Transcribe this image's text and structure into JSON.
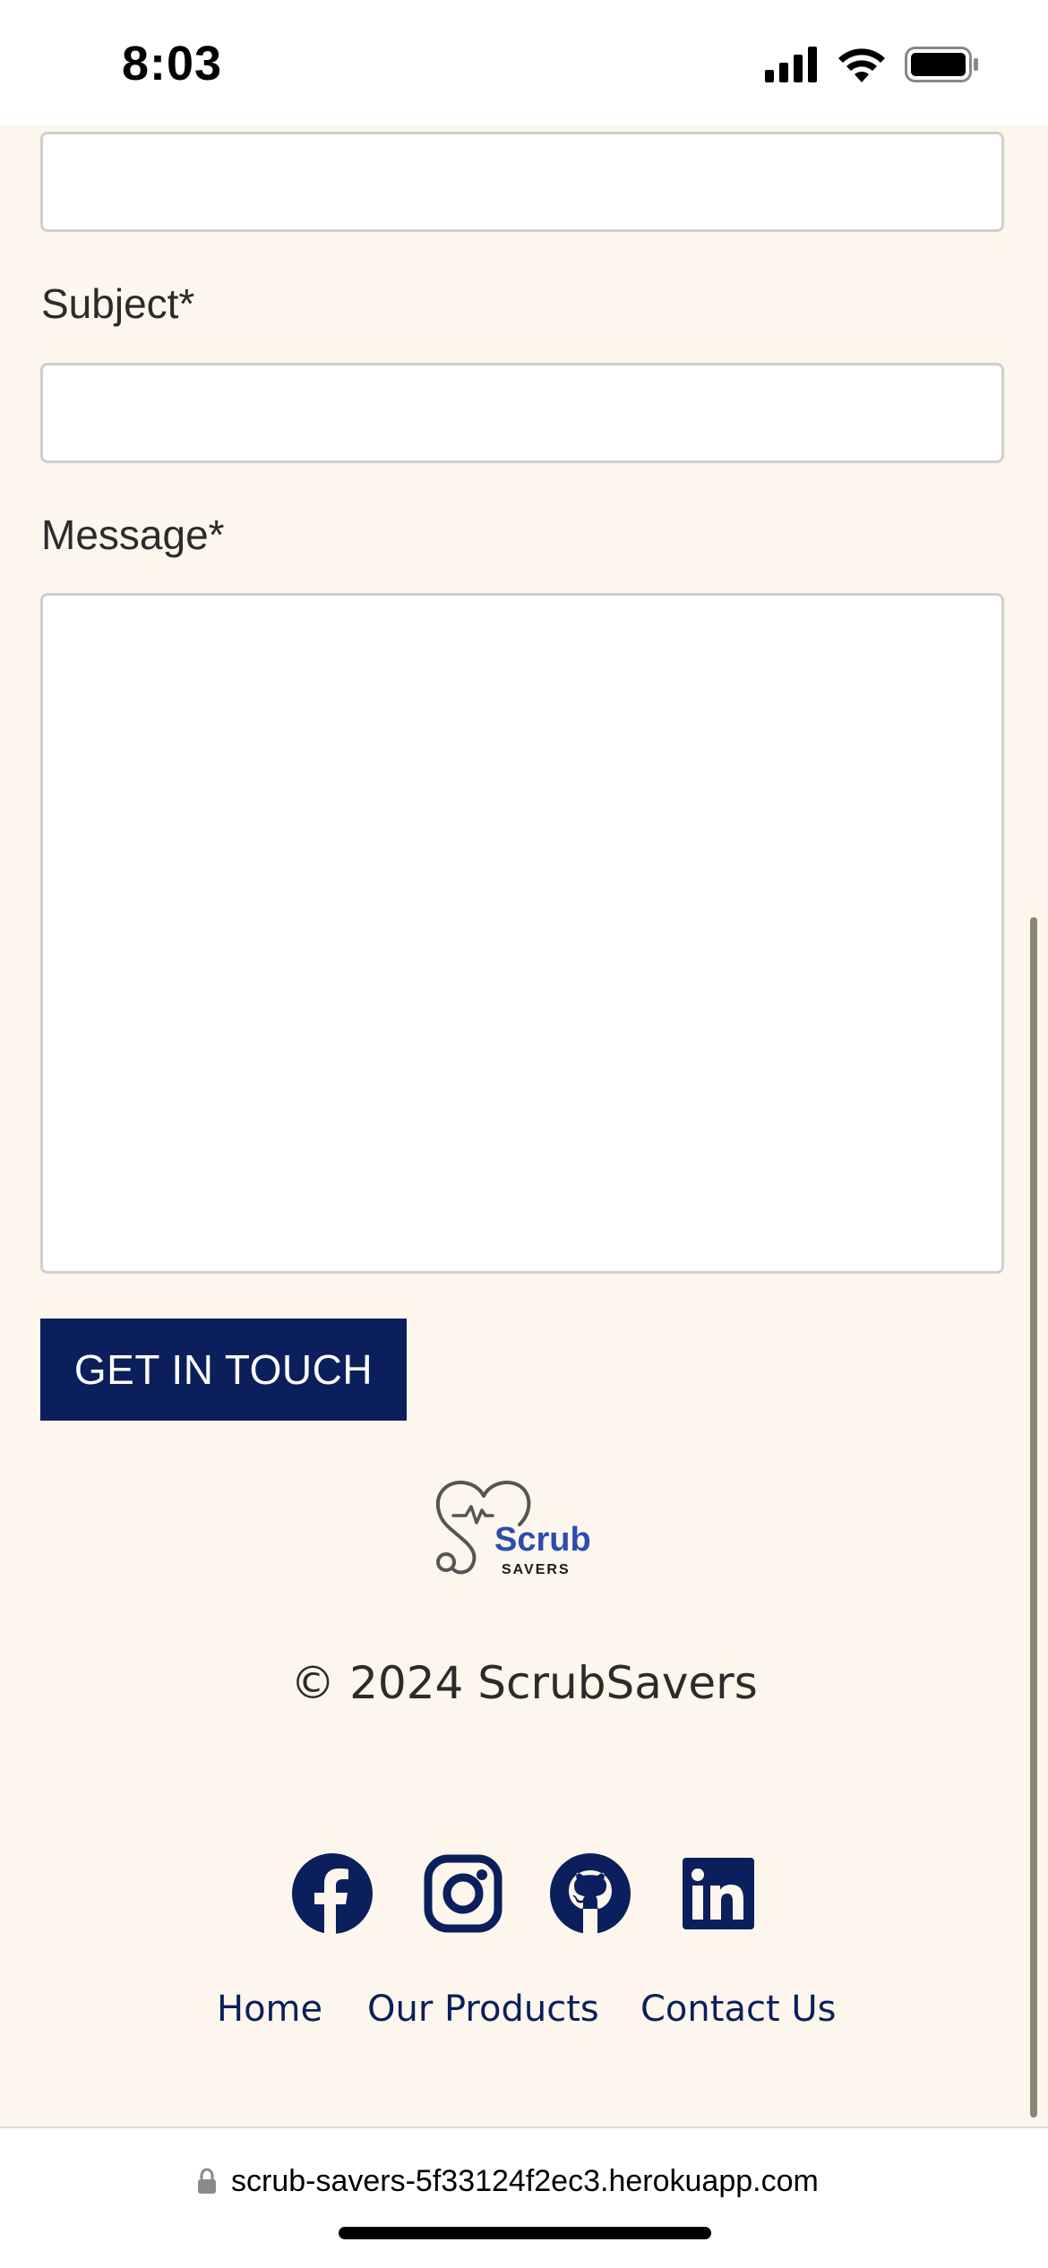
{
  "status_bar": {
    "time": "8:03",
    "icons": [
      "cellular-signal-icon",
      "wifi-icon",
      "battery-icon"
    ]
  },
  "form": {
    "subject_label": "Subject*",
    "message_label": "Message*",
    "submit_label": "GET IN TOUCH"
  },
  "footer": {
    "logo_text": "Scrub",
    "logo_subtext": "SAVERS",
    "copyright": "© 2024 ScrubSavers",
    "socials": [
      "facebook-icon",
      "instagram-icon",
      "github-icon",
      "linkedin-icon"
    ],
    "links": [
      "Home",
      "Our Products",
      "Contact Us"
    ]
  },
  "browser": {
    "url": "scrub-savers-5f33124f2ec3.herokuapp.com"
  },
  "colors": {
    "page_bg": "#fdf6ec",
    "brand_navy": "#0b1f5c",
    "logo_blue": "#2f4bb0"
  }
}
